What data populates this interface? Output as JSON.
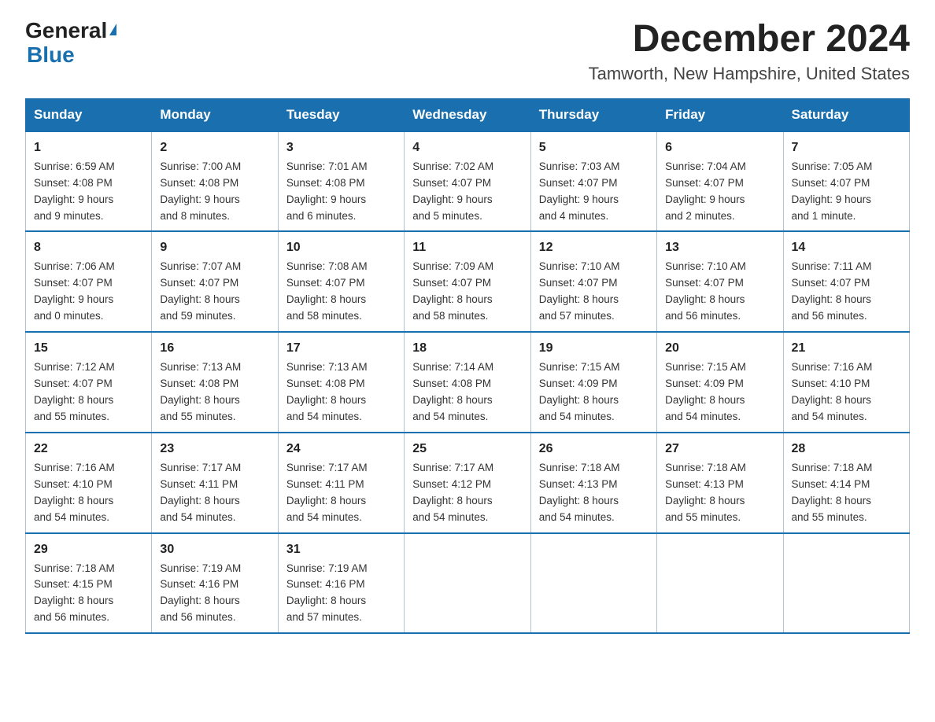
{
  "logo": {
    "general": "General",
    "triangle_color": "#1a6faf",
    "blue": "Blue"
  },
  "header": {
    "month_title": "December 2024",
    "location": "Tamworth, New Hampshire, United States"
  },
  "weekdays": [
    "Sunday",
    "Monday",
    "Tuesday",
    "Wednesday",
    "Thursday",
    "Friday",
    "Saturday"
  ],
  "weeks": [
    [
      {
        "day": "1",
        "sunrise": "6:59 AM",
        "sunset": "4:08 PM",
        "daylight": "9 hours and 9 minutes."
      },
      {
        "day": "2",
        "sunrise": "7:00 AM",
        "sunset": "4:08 PM",
        "daylight": "9 hours and 8 minutes."
      },
      {
        "day": "3",
        "sunrise": "7:01 AM",
        "sunset": "4:08 PM",
        "daylight": "9 hours and 6 minutes."
      },
      {
        "day": "4",
        "sunrise": "7:02 AM",
        "sunset": "4:07 PM",
        "daylight": "9 hours and 5 minutes."
      },
      {
        "day": "5",
        "sunrise": "7:03 AM",
        "sunset": "4:07 PM",
        "daylight": "9 hours and 4 minutes."
      },
      {
        "day": "6",
        "sunrise": "7:04 AM",
        "sunset": "4:07 PM",
        "daylight": "9 hours and 2 minutes."
      },
      {
        "day": "7",
        "sunrise": "7:05 AM",
        "sunset": "4:07 PM",
        "daylight": "9 hours and 1 minute."
      }
    ],
    [
      {
        "day": "8",
        "sunrise": "7:06 AM",
        "sunset": "4:07 PM",
        "daylight": "9 hours and 0 minutes."
      },
      {
        "day": "9",
        "sunrise": "7:07 AM",
        "sunset": "4:07 PM",
        "daylight": "8 hours and 59 minutes."
      },
      {
        "day": "10",
        "sunrise": "7:08 AM",
        "sunset": "4:07 PM",
        "daylight": "8 hours and 58 minutes."
      },
      {
        "day": "11",
        "sunrise": "7:09 AM",
        "sunset": "4:07 PM",
        "daylight": "8 hours and 58 minutes."
      },
      {
        "day": "12",
        "sunrise": "7:10 AM",
        "sunset": "4:07 PM",
        "daylight": "8 hours and 57 minutes."
      },
      {
        "day": "13",
        "sunrise": "7:10 AM",
        "sunset": "4:07 PM",
        "daylight": "8 hours and 56 minutes."
      },
      {
        "day": "14",
        "sunrise": "7:11 AM",
        "sunset": "4:07 PM",
        "daylight": "8 hours and 56 minutes."
      }
    ],
    [
      {
        "day": "15",
        "sunrise": "7:12 AM",
        "sunset": "4:07 PM",
        "daylight": "8 hours and 55 minutes."
      },
      {
        "day": "16",
        "sunrise": "7:13 AM",
        "sunset": "4:08 PM",
        "daylight": "8 hours and 55 minutes."
      },
      {
        "day": "17",
        "sunrise": "7:13 AM",
        "sunset": "4:08 PM",
        "daylight": "8 hours and 54 minutes."
      },
      {
        "day": "18",
        "sunrise": "7:14 AM",
        "sunset": "4:08 PM",
        "daylight": "8 hours and 54 minutes."
      },
      {
        "day": "19",
        "sunrise": "7:15 AM",
        "sunset": "4:09 PM",
        "daylight": "8 hours and 54 minutes."
      },
      {
        "day": "20",
        "sunrise": "7:15 AM",
        "sunset": "4:09 PM",
        "daylight": "8 hours and 54 minutes."
      },
      {
        "day": "21",
        "sunrise": "7:16 AM",
        "sunset": "4:10 PM",
        "daylight": "8 hours and 54 minutes."
      }
    ],
    [
      {
        "day": "22",
        "sunrise": "7:16 AM",
        "sunset": "4:10 PM",
        "daylight": "8 hours and 54 minutes."
      },
      {
        "day": "23",
        "sunrise": "7:17 AM",
        "sunset": "4:11 PM",
        "daylight": "8 hours and 54 minutes."
      },
      {
        "day": "24",
        "sunrise": "7:17 AM",
        "sunset": "4:11 PM",
        "daylight": "8 hours and 54 minutes."
      },
      {
        "day": "25",
        "sunrise": "7:17 AM",
        "sunset": "4:12 PM",
        "daylight": "8 hours and 54 minutes."
      },
      {
        "day": "26",
        "sunrise": "7:18 AM",
        "sunset": "4:13 PM",
        "daylight": "8 hours and 54 minutes."
      },
      {
        "day": "27",
        "sunrise": "7:18 AM",
        "sunset": "4:13 PM",
        "daylight": "8 hours and 55 minutes."
      },
      {
        "day": "28",
        "sunrise": "7:18 AM",
        "sunset": "4:14 PM",
        "daylight": "8 hours and 55 minutes."
      }
    ],
    [
      {
        "day": "29",
        "sunrise": "7:18 AM",
        "sunset": "4:15 PM",
        "daylight": "8 hours and 56 minutes."
      },
      {
        "day": "30",
        "sunrise": "7:19 AM",
        "sunset": "4:16 PM",
        "daylight": "8 hours and 56 minutes."
      },
      {
        "day": "31",
        "sunrise": "7:19 AM",
        "sunset": "4:16 PM",
        "daylight": "8 hours and 57 minutes."
      },
      null,
      null,
      null,
      null
    ]
  ],
  "labels": {
    "sunrise": "Sunrise:",
    "sunset": "Sunset:",
    "daylight": "Daylight:"
  }
}
